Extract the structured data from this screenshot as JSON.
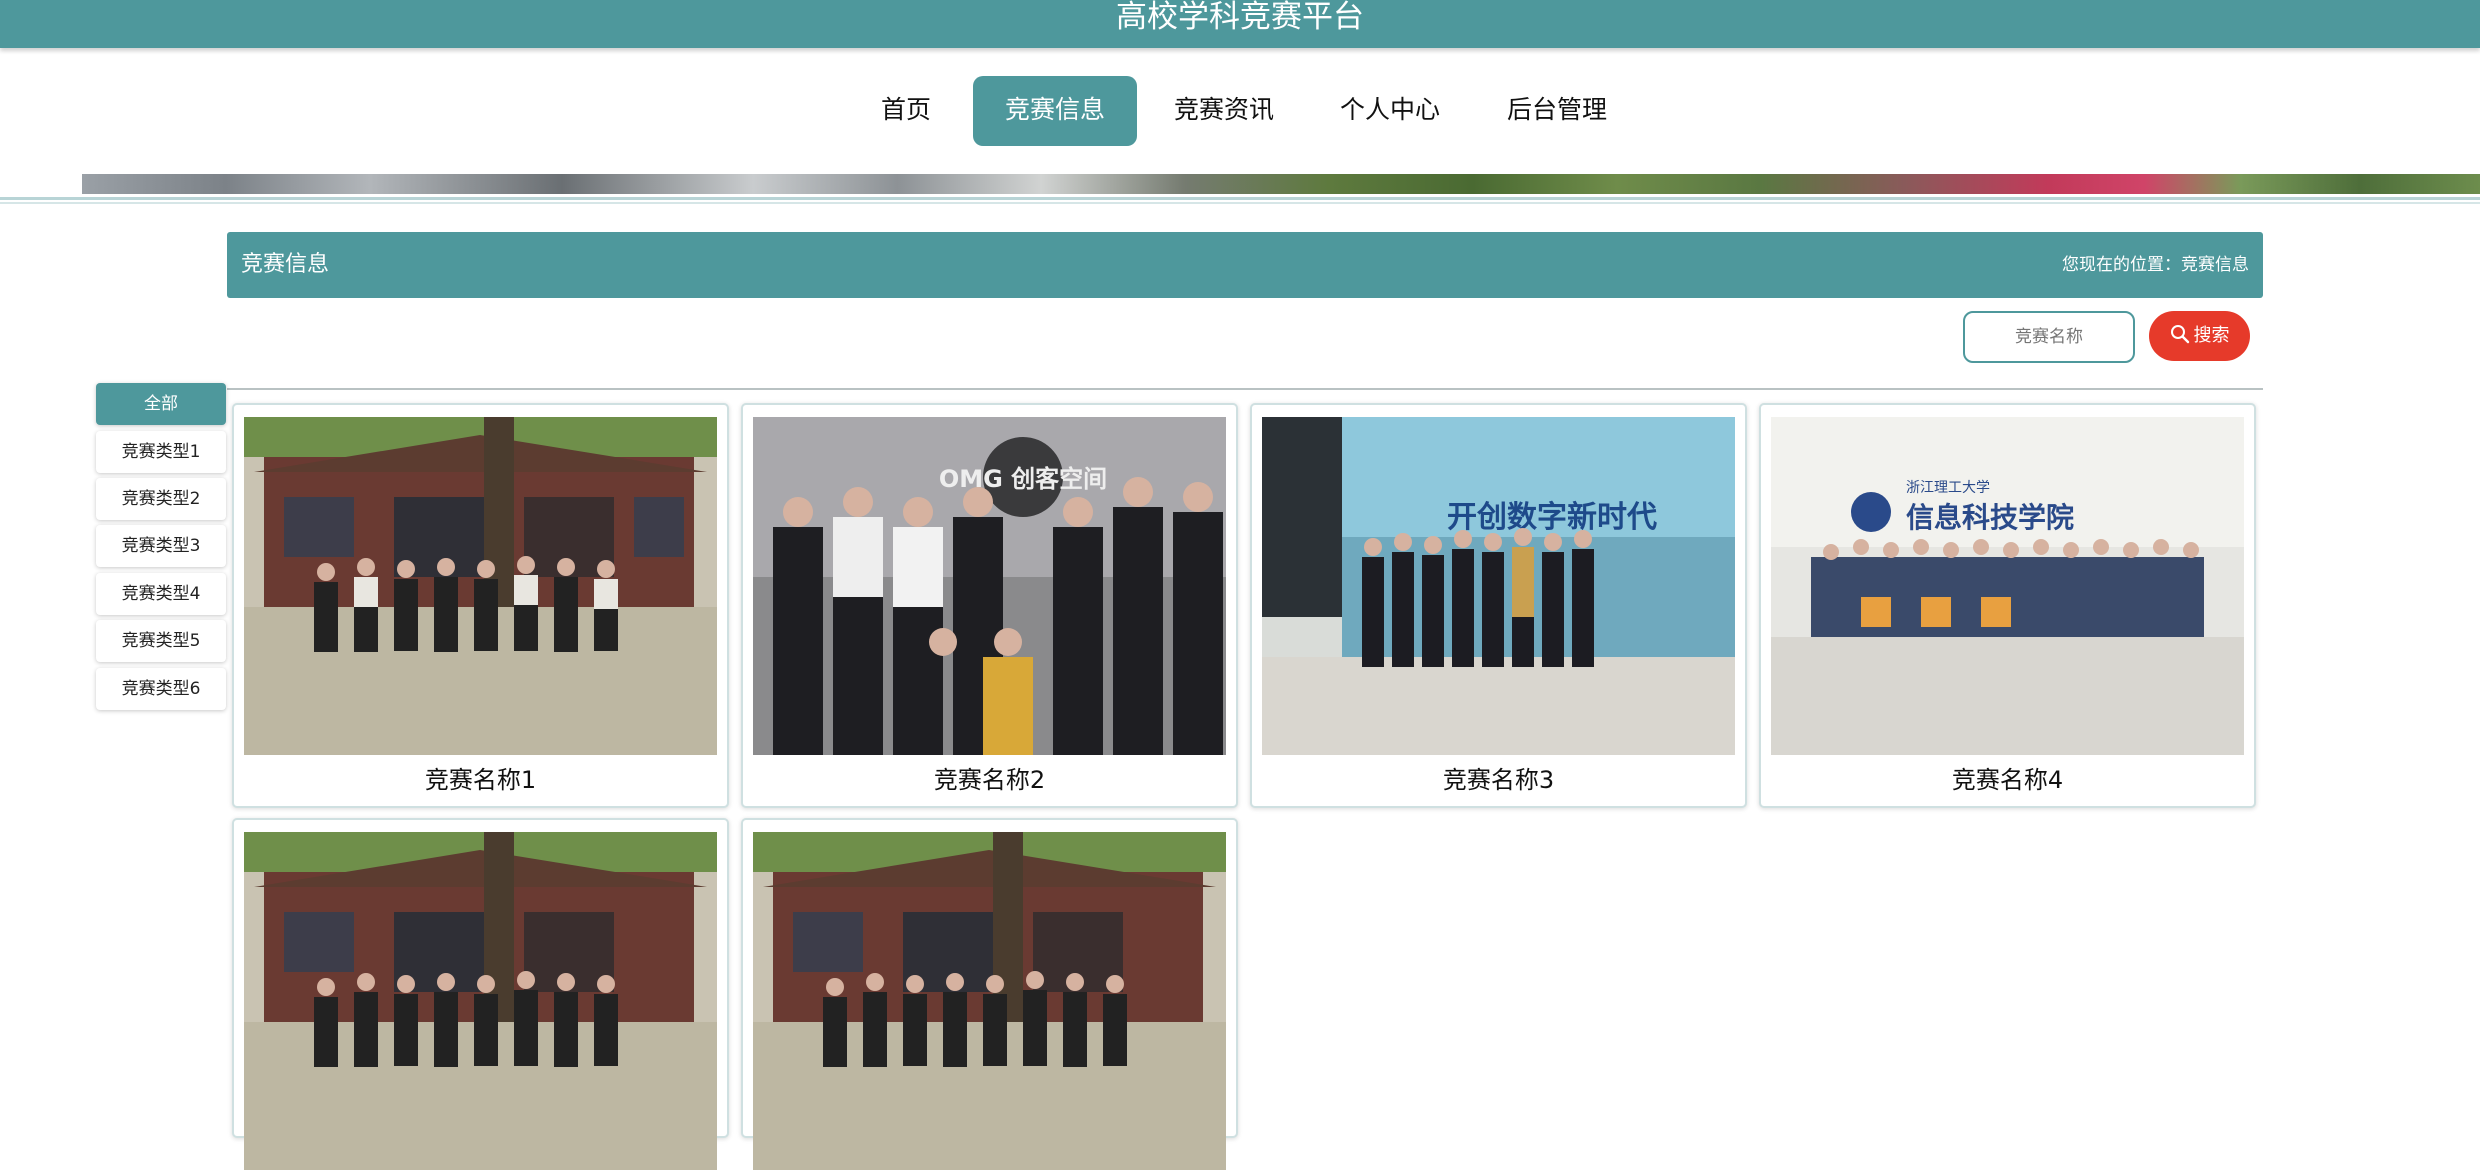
{
  "header": {
    "site_title": "高校学科竞赛平台"
  },
  "nav": {
    "items": [
      {
        "label": "首页",
        "active": false
      },
      {
        "label": "竞赛信息",
        "active": true
      },
      {
        "label": "竞赛资讯",
        "active": false
      },
      {
        "label": "个人中心",
        "active": false
      },
      {
        "label": "后台管理",
        "active": false
      }
    ]
  },
  "section": {
    "title": "竞赛信息",
    "breadcrumb": "您现在的位置：竞赛信息"
  },
  "search": {
    "placeholder": "竞赛名称",
    "button_label": "搜索",
    "icon": "search-icon"
  },
  "sidebar": {
    "items": [
      {
        "label": "全部",
        "active": true
      },
      {
        "label": "竞赛类型1"
      },
      {
        "label": "竞赛类型2"
      },
      {
        "label": "竞赛类型3"
      },
      {
        "label": "竞赛类型4"
      },
      {
        "label": "竞赛类型5"
      },
      {
        "label": "竞赛类型6"
      }
    ]
  },
  "cards": [
    {
      "title": "竞赛名称1"
    },
    {
      "title": "竞赛名称2"
    },
    {
      "title": "竞赛名称3"
    },
    {
      "title": "竞赛名称4"
    },
    {
      "title": ""
    },
    {
      "title": ""
    }
  ],
  "signage": {
    "card2_wall": "OMG 创客空间",
    "card3_screen": "开创数字新时代",
    "card4_wall": "信息科技学院",
    "card4_sub": "浙江理工大学"
  },
  "colors": {
    "accent": "#4e989c",
    "search_button": "#e63a2a"
  }
}
